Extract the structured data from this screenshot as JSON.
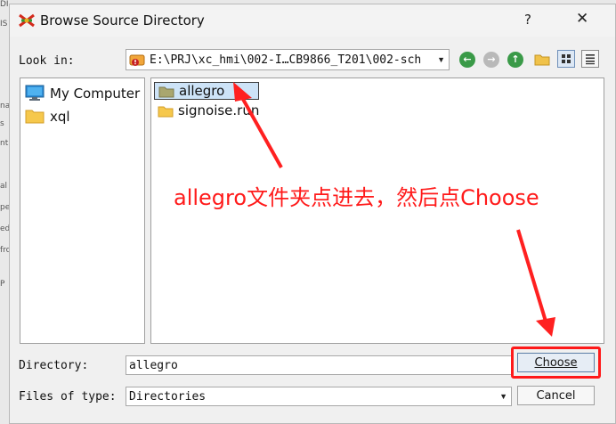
{
  "background": {
    "fragments": [
      "DI",
      "IS",
      "na",
      "s",
      "nt",
      "al",
      "pe",
      "ed",
      "fro",
      "P"
    ]
  },
  "window": {
    "title": "Browse Source Directory",
    "help_label": "?",
    "close_label": "✕",
    "icon": "app-logo-icon"
  },
  "lookin": {
    "label": "Look in:",
    "path": "E:\\PRJ\\xc_hmi\\002-I…CB9866_T201\\002-sch",
    "drive_icon": "drive-icon",
    "nav_buttons": [
      "back-icon",
      "forward-icon",
      "up-icon",
      "new-folder-icon",
      "icon-view-icon",
      "detail-view-icon"
    ]
  },
  "sidebar": {
    "items": [
      {
        "label": "My Computer",
        "icon": "computer-icon"
      },
      {
        "label": "xql",
        "icon": "folder-icon"
      }
    ]
  },
  "files": {
    "items": [
      {
        "label": "allegro",
        "icon": "folder-icon",
        "selected": true
      },
      {
        "label": "signoise.run",
        "icon": "folder-icon",
        "selected": false
      }
    ]
  },
  "annotation": {
    "text": "allegro文件夹点进去，然后点Choose",
    "color": "#ff1a1a"
  },
  "directory": {
    "label": "Directory:",
    "value": "allegro"
  },
  "filetype": {
    "label": "Files of type:",
    "value": "Directories"
  },
  "buttons": {
    "choose": "Choose",
    "cancel": "Cancel"
  },
  "colors": {
    "accent_nav": "#2e8b3e",
    "selection": "#cde3f7",
    "annotation_red": "#ff1a1a"
  }
}
